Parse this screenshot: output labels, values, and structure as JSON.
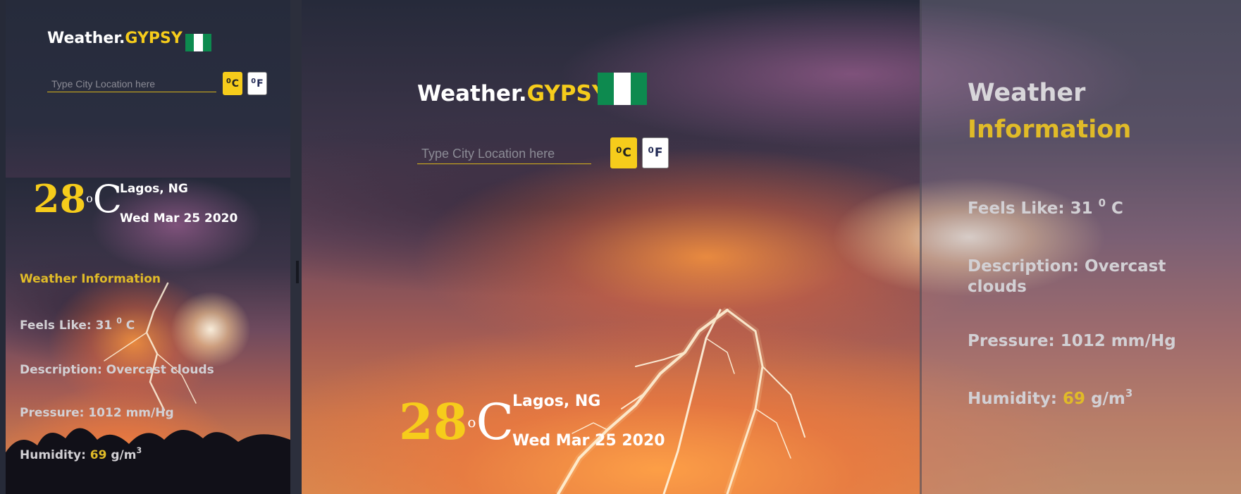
{
  "brand": {
    "name": "Weather.",
    "accent": "GYPSY"
  },
  "search": {
    "placeholder": "Type City Location here"
  },
  "units": {
    "celsius": "C",
    "fahrenheit": "F",
    "degree_mark": "0"
  },
  "current": {
    "temperature": "28",
    "degree_symbol": "o",
    "unit": "C",
    "location": "Lagos, NG",
    "date": "Wed Mar 25 2020"
  },
  "info": {
    "title": "Weather Information",
    "title_part1": "Weather",
    "title_part2": "Information",
    "feels_like_label": "Feels Like: 31",
    "feels_like_deg": "0",
    "feels_like_unit": "C",
    "description_label": "Description:",
    "description_value": "Overcast clouds",
    "description_full": "Description: Overcast clouds",
    "pressure": "Pressure: 1012 mm/Hg",
    "humidity_label": "Humidity:",
    "humidity_value": "69",
    "humidity_unit": "g/m",
    "humidity_exp": "3"
  },
  "colors": {
    "accent": "#f6cc1b",
    "flag_green": "#0d8a4f",
    "panel_dark": "#262a38"
  }
}
